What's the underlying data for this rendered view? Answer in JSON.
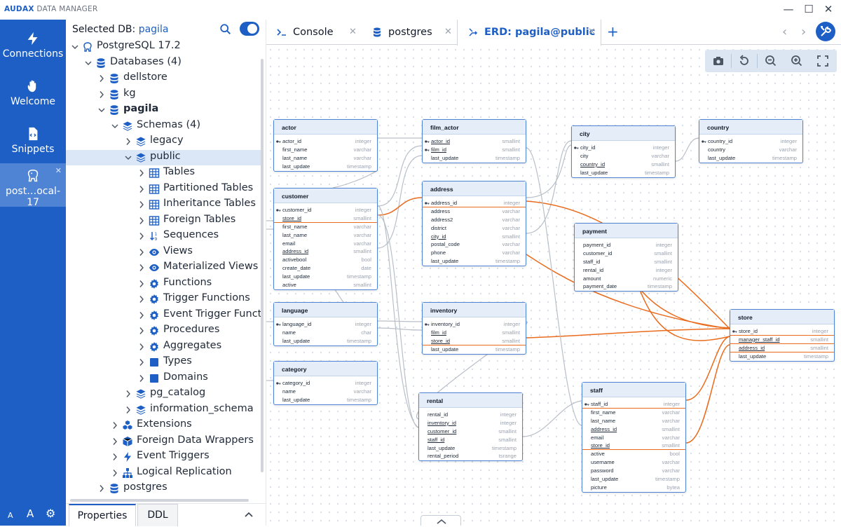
{
  "app": {
    "brand_strong": "AUDAX",
    "brand_rest": " DATA MANAGER"
  },
  "window_controls": {
    "minimize": "—",
    "maximize": "☐",
    "close": "✕"
  },
  "leftnav": {
    "items": [
      {
        "label": "Connections",
        "icon": "bolt-icon"
      },
      {
        "label": "Welcome",
        "icon": "hand-wave-icon"
      },
      {
        "label": "Snippets",
        "icon": "code-file-icon"
      }
    ],
    "active_connection": {
      "label": "post…ocal-17",
      "icon": "postgres-elephant-icon",
      "close": "✕"
    },
    "bottom": [
      "A",
      "A",
      "⚙"
    ]
  },
  "sidebar": {
    "selected_db_label": "Selected DB: ",
    "selected_db": "pagila",
    "tree": [
      {
        "label": "PostgreSQL 17.2",
        "depth": 0,
        "icon": "elephant",
        "caret": "open"
      },
      {
        "label": "Databases (4)",
        "depth": 1,
        "icon": "db",
        "caret": "open"
      },
      {
        "label": "dellstore",
        "depth": 2,
        "icon": "db",
        "caret": "closed"
      },
      {
        "label": "kg",
        "depth": 2,
        "icon": "db",
        "caret": "closed"
      },
      {
        "label": "pagila",
        "depth": 2,
        "icon": "db",
        "caret": "open",
        "bold": true
      },
      {
        "label": "Schemas (4)",
        "depth": 3,
        "icon": "layers",
        "caret": "open"
      },
      {
        "label": "legacy",
        "depth": 4,
        "icon": "layers",
        "caret": "closed"
      },
      {
        "label": "public",
        "depth": 4,
        "icon": "layers",
        "caret": "open",
        "selected": true
      },
      {
        "label": "Tables",
        "depth": 5,
        "icon": "grid",
        "caret": "closed"
      },
      {
        "label": "Partitioned Tables",
        "depth": 5,
        "icon": "grid",
        "caret": "closed"
      },
      {
        "label": "Inheritance Tables",
        "depth": 5,
        "icon": "grid",
        "caret": "closed"
      },
      {
        "label": "Foreign Tables",
        "depth": 5,
        "icon": "grid",
        "caret": "closed"
      },
      {
        "label": "Sequences",
        "depth": 5,
        "icon": "sort",
        "caret": "closed"
      },
      {
        "label": "Views",
        "depth": 5,
        "icon": "eye",
        "caret": "closed"
      },
      {
        "label": "Materialized Views",
        "depth": 5,
        "icon": "eye",
        "caret": "closed"
      },
      {
        "label": "Functions",
        "depth": 5,
        "icon": "gear",
        "caret": "closed"
      },
      {
        "label": "Trigger Functions",
        "depth": 5,
        "icon": "gear",
        "caret": "closed"
      },
      {
        "label": "Event Trigger Functions",
        "depth": 5,
        "icon": "gear",
        "caret": "closed"
      },
      {
        "label": "Procedures",
        "depth": 5,
        "icon": "gear",
        "caret": "closed"
      },
      {
        "label": "Aggregates",
        "depth": 5,
        "icon": "gear",
        "caret": "closed"
      },
      {
        "label": "Types",
        "depth": 5,
        "icon": "square",
        "caret": "closed"
      },
      {
        "label": "Domains",
        "depth": 5,
        "icon": "square",
        "caret": "closed"
      },
      {
        "label": "pg_catalog",
        "depth": 4,
        "icon": "layers",
        "caret": "closed"
      },
      {
        "label": "information_schema",
        "depth": 4,
        "icon": "layers",
        "caret": "closed"
      },
      {
        "label": "Extensions",
        "depth": 3,
        "icon": "cubes",
        "caret": "closed"
      },
      {
        "label": "Foreign Data Wrappers",
        "depth": 3,
        "icon": "box",
        "caret": "closed"
      },
      {
        "label": "Event Triggers",
        "depth": 3,
        "icon": "bolt",
        "caret": "closed"
      },
      {
        "label": "Logical Replication",
        "depth": 3,
        "icon": "sitemap",
        "caret": "closed"
      },
      {
        "label": "postgres",
        "depth": 2,
        "icon": "db",
        "caret": "closed"
      }
    ],
    "bottom_tabs": [
      "Properties",
      "DDL"
    ],
    "bottom_caret": "^"
  },
  "tabs": [
    {
      "label": "Console",
      "icon": "terminal-icon",
      "close": "✕"
    },
    {
      "label": "postgres",
      "icon": "database-icon",
      "close": "✕"
    },
    {
      "label": "ERD: pagila@public",
      "icon": "erd-icon",
      "close": "✕",
      "active": true
    }
  ],
  "tab_add": "+",
  "tab_nav": {
    "prev": "‹",
    "next": "›"
  },
  "colors": {
    "accent": "#1d5fc4",
    "relation_highlight": "#ea6b1c",
    "relation": "#b9bfc8",
    "entity_header": "#e5edf8"
  },
  "erd": {
    "entities": [
      {
        "name": "actor",
        "cols": [
          [
            "actor_id",
            "integer",
            "pk"
          ],
          [
            "first_name",
            "varchar"
          ],
          [
            "last_name",
            "varchar"
          ],
          [
            "last_update",
            "timestamp"
          ]
        ]
      },
      {
        "name": "film_actor",
        "cols": [
          [
            "actor_id",
            "smallint",
            "pkfk"
          ],
          [
            "film_id",
            "smallint",
            "pkfk"
          ],
          [
            "last_update",
            "timestamp"
          ]
        ]
      },
      {
        "name": "city",
        "cols": [
          [
            "city_id",
            "integer",
            "pk"
          ],
          [
            "city",
            "varchar"
          ],
          [
            "country_id",
            "smallint",
            "fk"
          ],
          [
            "last_update",
            "timestamp"
          ]
        ]
      },
      {
        "name": "country",
        "cols": [
          [
            "country_id",
            "integer",
            "pk"
          ],
          [
            "country",
            "varchar"
          ],
          [
            "last_update",
            "timestamp"
          ]
        ]
      },
      {
        "name": "customer",
        "cols": [
          [
            "customer_id",
            "integer",
            "pk"
          ],
          [
            "store_id",
            "smallint",
            "fk",
            "hl"
          ],
          [
            "first_name",
            "varchar"
          ],
          [
            "last_name",
            "varchar"
          ],
          [
            "email",
            "varchar"
          ],
          [
            "address_id",
            "smallint",
            "fk"
          ],
          [
            "activebool",
            "bool"
          ],
          [
            "create_date",
            "date"
          ],
          [
            "last_update",
            "timestamp"
          ],
          [
            "active",
            "smallint"
          ]
        ]
      },
      {
        "name": "address",
        "cols": [
          [
            "address_id",
            "integer",
            "pk",
            "hl"
          ],
          [
            "address",
            "varchar"
          ],
          [
            "address2",
            "varchar"
          ],
          [
            "district",
            "varchar"
          ],
          [
            "city_id",
            "smallint",
            "fk"
          ],
          [
            "postal_code",
            "varchar"
          ],
          [
            "phone",
            "varchar"
          ],
          [
            "last_update",
            "timestamp"
          ]
        ]
      },
      {
        "name": "payment",
        "cols": [
          [
            "payment_id",
            "integer"
          ],
          [
            "customer_id",
            "smallint"
          ],
          [
            "staff_id",
            "smallint"
          ],
          [
            "rental_id",
            "integer"
          ],
          [
            "amount",
            "numeric"
          ],
          [
            "payment_date",
            "timestamp"
          ]
        ]
      },
      {
        "name": "language",
        "cols": [
          [
            "language_id",
            "integer",
            "pk"
          ],
          [
            "name",
            "char"
          ],
          [
            "last_update",
            "timestamp"
          ]
        ]
      },
      {
        "name": "inventory",
        "cols": [
          [
            "inventory_id",
            "integer",
            "pk"
          ],
          [
            "film_id",
            "smallint",
            "fk"
          ],
          [
            "store_id",
            "smallint",
            "fk",
            "hl"
          ],
          [
            "last_update",
            "timestamp"
          ]
        ]
      },
      {
        "name": "store",
        "cols": [
          [
            "store_id",
            "integer",
            "pk",
            "hl"
          ],
          [
            "manager_staff_id",
            "smallint",
            "fk",
            "hl"
          ],
          [
            "address_id",
            "smallint",
            "fk",
            "hl"
          ],
          [
            "last_update",
            "timestamp"
          ]
        ]
      },
      {
        "name": "category",
        "cols": [
          [
            "category_id",
            "integer",
            "pk"
          ],
          [
            "name",
            "varchar"
          ],
          [
            "last_update",
            "timestamp"
          ]
        ]
      },
      {
        "name": "rental",
        "cols": [
          [
            "rental_id",
            "integer"
          ],
          [
            "inventory_id",
            "integer",
            "fk"
          ],
          [
            "customer_id",
            "smallint",
            "fk"
          ],
          [
            "staff_id",
            "smallint",
            "fk"
          ],
          [
            "last_update",
            "timestamp"
          ],
          [
            "rental_period",
            "tsrange"
          ]
        ]
      },
      {
        "name": "staff",
        "cols": [
          [
            "staff_id",
            "integer",
            "pk",
            "hl"
          ],
          [
            "first_name",
            "varchar"
          ],
          [
            "last_name",
            "varchar"
          ],
          [
            "address_id",
            "smallint",
            "fk"
          ],
          [
            "email",
            "varchar"
          ],
          [
            "store_id",
            "smallint",
            "fk",
            "hl"
          ],
          [
            "active",
            "bool"
          ],
          [
            "username",
            "varchar"
          ],
          [
            "password",
            "varchar"
          ],
          [
            "last_update",
            "timestamp"
          ],
          [
            "picture",
            "bytea"
          ]
        ]
      }
    ]
  },
  "canvas_toolbar": [
    "camera-icon",
    "reset-icon",
    "zoom-out-icon",
    "zoom-in-icon",
    "fit-screen-icon"
  ]
}
